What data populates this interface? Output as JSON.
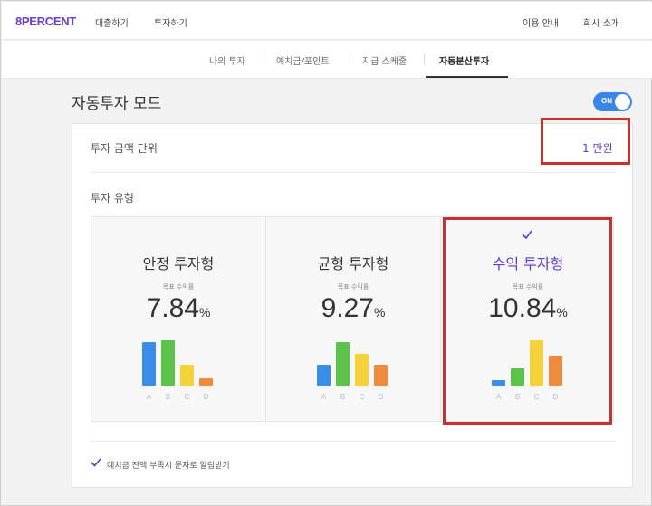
{
  "header": {
    "logo": "8PERCENT",
    "nav_left": [
      "대출하기",
      "투자하기"
    ],
    "nav_right": [
      "이용 안내",
      "회사 소개"
    ]
  },
  "subnav": {
    "tabs": [
      {
        "label": "나의 투자",
        "active": false
      },
      {
        "label": "예치금/포인트",
        "active": false
      },
      {
        "label": "지급 스케줄",
        "active": false
      },
      {
        "label": "자동분산투자",
        "active": true
      }
    ]
  },
  "mode": {
    "title": "자동투자 모드",
    "toggle_label": "ON",
    "toggle_on": true
  },
  "unit": {
    "label": "투자 금액 단위",
    "value": "1 만원"
  },
  "investment_type": {
    "label": "투자 유형",
    "cards": [
      {
        "title": "안정 투자형",
        "target_label": "목표 수익률",
        "rate": "7.84",
        "unit": "%",
        "selected": false,
        "bars": [
          {
            "label": "A",
            "value": 0.95
          },
          {
            "label": "B",
            "value": 1.0
          },
          {
            "label": "C",
            "value": 0.45
          },
          {
            "label": "D",
            "value": 0.15
          }
        ]
      },
      {
        "title": "균형 투자형",
        "target_label": "목표 수익률",
        "rate": "9.27",
        "unit": "%",
        "selected": false,
        "bars": [
          {
            "label": "A",
            "value": 0.45
          },
          {
            "label": "B",
            "value": 0.95
          },
          {
            "label": "C",
            "value": 0.7
          },
          {
            "label": "D",
            "value": 0.45
          }
        ]
      },
      {
        "title": "수익 투자형",
        "target_label": "목표 수익률",
        "rate": "10.84",
        "unit": "%",
        "selected": true,
        "bars": [
          {
            "label": "A",
            "value": 0.12
          },
          {
            "label": "B",
            "value": 0.38
          },
          {
            "label": "C",
            "value": 1.0
          },
          {
            "label": "D",
            "value": 0.65
          }
        ]
      }
    ]
  },
  "notify": {
    "text": "예치금 잔액 부족시 문자로 알림받기",
    "checked": true
  },
  "colors": {
    "accent": "#5b3ec8",
    "toggle": "#3a86e8",
    "highlight": "#c8322c",
    "bar_a": "#3a8ee6",
    "bar_b": "#5cc24a",
    "bar_c": "#f5d23a",
    "bar_d": "#ee8a3c"
  }
}
